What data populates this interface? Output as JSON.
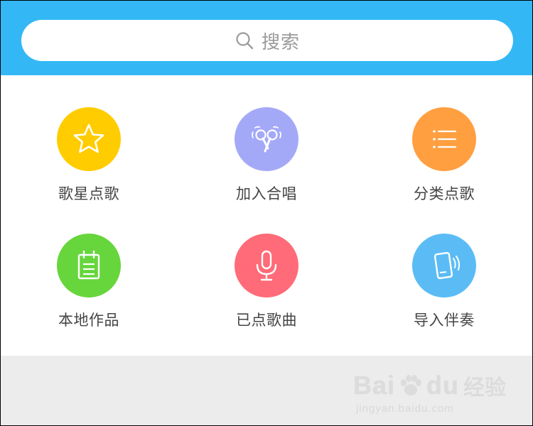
{
  "search": {
    "placeholder": "搜索"
  },
  "menu": {
    "items": [
      {
        "label": "歌星点歌",
        "icon": "star-icon",
        "color": "#ffcc00"
      },
      {
        "label": "加入合唱",
        "icon": "duet-microphones-icon",
        "color": "#a4a9f7"
      },
      {
        "label": "分类点歌",
        "icon": "list-icon",
        "color": "#ff9f40"
      },
      {
        "label": "本地作品",
        "icon": "notebook-icon",
        "color": "#66d63c"
      },
      {
        "label": "已点歌曲",
        "icon": "microphone-icon",
        "color": "#ff6b78"
      },
      {
        "label": "导入伴奏",
        "icon": "phone-vibrate-icon",
        "color": "#5bbcf5"
      }
    ]
  },
  "colors": {
    "header": "#33b8f5",
    "footer": "#ececec"
  },
  "watermark": {
    "brand": "Bai",
    "brand_suffix": "du",
    "cn": "经验",
    "url": "jingyan.baidu.com"
  }
}
